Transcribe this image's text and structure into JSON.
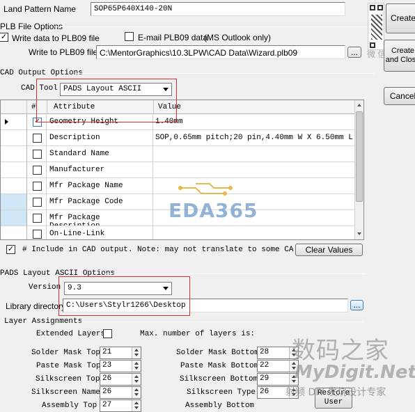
{
  "land_pattern": {
    "label": "Land Pattern Name",
    "value": "SOP65P640X140-20N"
  },
  "plb_options": {
    "group_title": "PLB File Options",
    "write_label": "Write data to PLB09 file",
    "write_checked": true,
    "email_label": "E-mail PLB09 data",
    "email_note": "(MS Outlook only)",
    "email_checked": false,
    "write_to_label": "Write to PLB09 file",
    "write_to_value": "C:\\MentorGraphics\\10.3LPW\\CAD Data\\Wizard.plb09",
    "browse_label": "..."
  },
  "cad_output": {
    "group_title": "CAD Output Options",
    "tool_label": "CAD Tool",
    "tool_value": "PADS Layout ASCII",
    "columns": {
      "num": "#",
      "attribute": "Attribute",
      "value": "Value"
    },
    "rows": [
      {
        "attribute": "Geometry Height",
        "value": "1.40mm",
        "checked": true
      },
      {
        "attribute": "Description",
        "value": "SOP,0.65mm pitch;20 pin,4.40mm W X 6.50mm L...",
        "checked": false
      },
      {
        "attribute": "Standard Name",
        "value": "",
        "checked": false
      },
      {
        "attribute": "Manufacturer",
        "value": "",
        "checked": false
      },
      {
        "attribute": "Mfr Package Name",
        "value": "",
        "checked": false
      },
      {
        "attribute": "Mfr Package Code",
        "value": "",
        "checked": false
      },
      {
        "attribute": "Mfr Package Description",
        "value": "",
        "checked": false
      },
      {
        "attribute": "On-Line-Link",
        "value": "",
        "checked": false
      }
    ],
    "include_note": "# Include in CAD output.  Note: may not translate to some CAD sof",
    "include_checked": true,
    "clear_values_label": "Clear Values"
  },
  "pads_options": {
    "group_title": "PADS Layout ASCII Options",
    "version_label": "Version",
    "version_value": "9.3",
    "library_label": "Library directory",
    "library_value": "C:\\Users\\Stylr1266\\Desktop",
    "browse_label": "..."
  },
  "layer_assignments": {
    "group_title": "Layer Assignments",
    "extended_label": "Extended Layers",
    "extended_checked": false,
    "max_layers_label": "Max. number of layers is:",
    "left": [
      {
        "label": "Solder Mask Top",
        "value": "21"
      },
      {
        "label": "Paste Mask Top",
        "value": "23"
      },
      {
        "label": "Silkscreen Top",
        "value": "26"
      },
      {
        "label": "Silkscreen Name",
        "value": "26"
      },
      {
        "label": "Assembly Top",
        "value": "27"
      }
    ],
    "right": [
      {
        "label": "Solder Mask Bottom",
        "value": "28"
      },
      {
        "label": "Paste Mask Bottom",
        "value": "22"
      },
      {
        "label": "Silkscreen Bottom",
        "value": "29"
      },
      {
        "label": "Silkscreen Type",
        "value": "26"
      },
      {
        "label": "Assembly Bottom",
        "value": ""
      }
    ]
  },
  "side_buttons": {
    "create": "Create",
    "create_close": "Create and Close",
    "cancel": "Cancel",
    "restore": "Restore",
    "restore_user": "User"
  },
  "watermarks": {
    "eda": "EDA365",
    "cn_brand": "数码之家",
    "mydigit": "MyDigit.Net",
    "cn_slogan": "射频 DIY 发烧设计专家",
    "wechat": "微 信"
  }
}
